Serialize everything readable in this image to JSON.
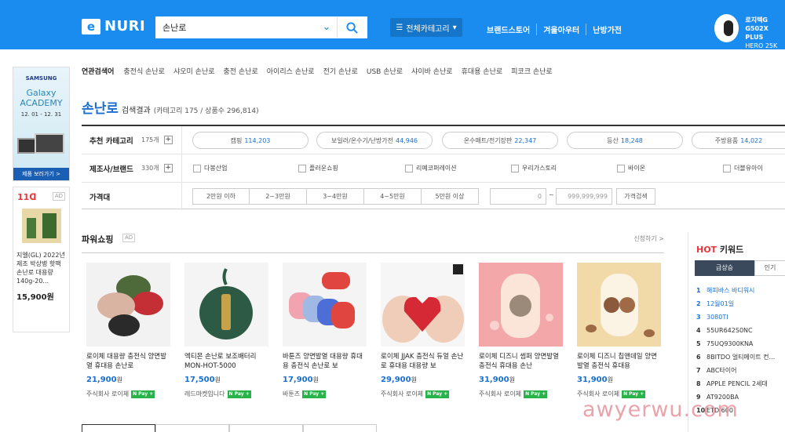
{
  "header": {
    "logo_box": "e",
    "logo_text": "NURI",
    "search_value": "손난로",
    "category_button": "전체카테고리",
    "nav": [
      "브랜드스토어",
      "겨울아우터",
      "난방가전"
    ],
    "promo_line1": "로지텍G",
    "promo_line2": "G502X PLUS",
    "promo_line3": "HERO 25K 센서"
  },
  "left_ads": {
    "samsung_brand": "SAMSUNG",
    "samsung_line1": "Galaxy",
    "samsung_line2": "ACADEMY",
    "samsung_date": "12. 01 - 12. 31",
    "samsung_button": "제품 보러가기 >",
    "ad11_logo": "11ᗡ",
    "ad_tag": "AD",
    "ad11_desc": "지엘(GL) 2022년제조 박상병 핫팩 손난로 대용량 140g-20...",
    "ad11_price": "15,900원"
  },
  "related": {
    "title": "연관검색어",
    "items": [
      "충전식 손난로",
      "샤오미 손난로",
      "충전 손난로",
      "아이리스 손난로",
      "전기 손난로",
      "USB 손난로",
      "샤이바 손난로",
      "휴대용 손난로",
      "피코크 손난로"
    ]
  },
  "result": {
    "keyword": "손난로",
    "suffix": "검색결과",
    "count": "(카테고리 175 / 상품수 296,814)"
  },
  "filters": {
    "category_label": "추천 카테고리",
    "category_count": "175개",
    "category_pills": [
      {
        "name": "캠핑",
        "num": "114,203"
      },
      {
        "name": "보일러/온수기/난방가전",
        "num": "44,946"
      },
      {
        "name": "온수매트/전기장판",
        "num": "22,347"
      },
      {
        "name": "등산",
        "num": "18,248"
      },
      {
        "name": "주방용품",
        "num": "14,022"
      }
    ],
    "brand_label": "제조사/브랜드",
    "brand_count": "330개",
    "brands": [
      "다봉산업",
      "플러운쇼핑",
      "리예코퍼레이션",
      "우리가스토리",
      "바이온",
      "더블유아이"
    ],
    "price_label": "가격대",
    "price_ranges": [
      "2만원 이하",
      "2~3만원",
      "3~4만원",
      "4~5만원",
      "5만원 이상"
    ],
    "price_min": "0",
    "price_max": "999,999,999",
    "price_tilde": "~",
    "price_search": "가격검색",
    "plus": "+"
  },
  "power_shopping": {
    "title": "파워쇼핑",
    "ad": "AD",
    "apply": "신청하기 >",
    "products": [
      {
        "name": "로이체 대용량 충전식 양면발열 휴대용 손난로",
        "price": "21,900",
        "seller": "주식회사 로이체"
      },
      {
        "name": "엑티몬 손난로 보조배터리 MON-HOT-5000",
        "price": "17,500",
        "seller": "레드마켓입니다"
      },
      {
        "name": "바툰즈 양면발열 대용량 휴대용 충전식 손난로 보",
        "price": "17,900",
        "seller": "바툰즈"
      },
      {
        "name": "로이체 JJAK 충전식 듀얼 손난로 휴대용 대용량 보",
        "price": "29,900",
        "seller": "주식회사 로이체"
      },
      {
        "name": "로이체 디즈니 썸퍼 양면발열 충전식 휴대용 손난",
        "price": "31,900",
        "seller": "주식회사 로이체"
      },
      {
        "name": "로이체 디즈니 칩앤데일 양면발열 충전식 휴대용",
        "price": "31,900",
        "seller": "주식회사 로이체"
      }
    ],
    "won": "원",
    "npay": "N Pay +"
  },
  "hot_keywords": {
    "title_hot": "HOT",
    "title_rest": " 키워드",
    "tab_active": "급상승",
    "tab_other": "인기",
    "items": [
      "해피바스 바디워시",
      "12월01일",
      "3080TI",
      "55UR642S0NC",
      "75UQ9300KNA",
      "8BITDO 얼티메이트 컨...",
      "ABC타이어",
      "APPLE PENCIL 2세대",
      "AT9200BA",
      "ETD 600"
    ]
  },
  "watermark": "awyerwu.com",
  "colors": {
    "brand_blue": "#1a8cf0",
    "link_blue": "#1a6fd0",
    "npay_green": "#27b24a"
  }
}
